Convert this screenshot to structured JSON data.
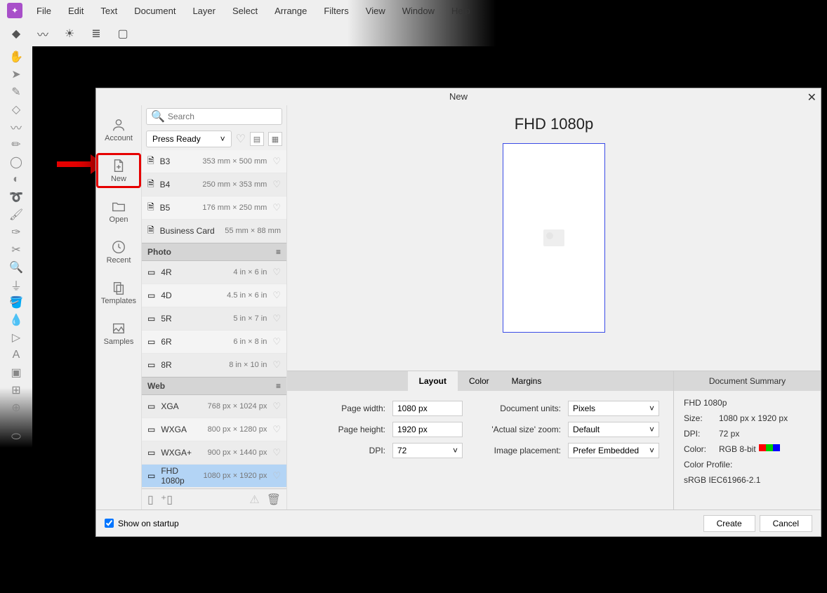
{
  "menu": [
    "File",
    "Edit",
    "Text",
    "Document",
    "Layer",
    "Select",
    "Arrange",
    "Filters",
    "View",
    "Window",
    "Help"
  ],
  "dialog": {
    "title": "New"
  },
  "search": {
    "placeholder": "Search"
  },
  "category": {
    "selected": "Press Ready"
  },
  "sidenav": [
    {
      "label": "Account"
    },
    {
      "label": "New"
    },
    {
      "label": "Open"
    },
    {
      "label": "Recent"
    },
    {
      "label": "Templates"
    },
    {
      "label": "Samples"
    }
  ],
  "groups": {
    "print": [
      {
        "name": "B3",
        "dim": "353 mm × 500 mm"
      },
      {
        "name": "B4",
        "dim": "250 mm × 353 mm"
      },
      {
        "name": "B5",
        "dim": "176 mm × 250 mm"
      },
      {
        "name": "Business Card",
        "dim": "55 mm × 88 mm"
      }
    ],
    "photo_header": "Photo",
    "photo": [
      {
        "name": "4R",
        "dim": "4 in × 6 in"
      },
      {
        "name": "4D",
        "dim": "4.5 in × 6 in"
      },
      {
        "name": "5R",
        "dim": "5 in × 7 in"
      },
      {
        "name": "6R",
        "dim": "6 in × 8 in"
      },
      {
        "name": "8R",
        "dim": "8 in × 10 in"
      }
    ],
    "web_header": "Web",
    "web": [
      {
        "name": "XGA",
        "dim": "768 px × 1024 px"
      },
      {
        "name": "WXGA",
        "dim": "800 px × 1280 px"
      },
      {
        "name": "WXGA+",
        "dim": "900 px × 1440 px"
      },
      {
        "name": "FHD 1080p",
        "dim": "1080 px × 1920 px"
      }
    ]
  },
  "preview": {
    "title": "FHD 1080p"
  },
  "tabs": {
    "layout": "Layout",
    "color": "Color",
    "margins": "Margins"
  },
  "form": {
    "page_width_label": "Page width:",
    "page_width": "1080 px",
    "page_height_label": "Page height:",
    "page_height": "1920 px",
    "dpi_label": "DPI:",
    "dpi": "72",
    "units_label": "Document units:",
    "units": "Pixels",
    "zoom_label": "'Actual size' zoom:",
    "zoom": "Default",
    "placement_label": "Image placement:",
    "placement": "Prefer Embedded"
  },
  "summary": {
    "title": "Document Summary",
    "name": "FHD 1080p",
    "size_label": "Size:",
    "size": "1080 px  x  1920 px",
    "dpi_label": "DPI:",
    "dpi": "72 px",
    "color_label": "Color:",
    "color": "RGB 8-bit",
    "profile_label": "Color Profile:",
    "profile": "sRGB IEC61966-2.1"
  },
  "footer": {
    "show_on_startup": "Show on startup",
    "create": "Create",
    "cancel": "Cancel"
  }
}
